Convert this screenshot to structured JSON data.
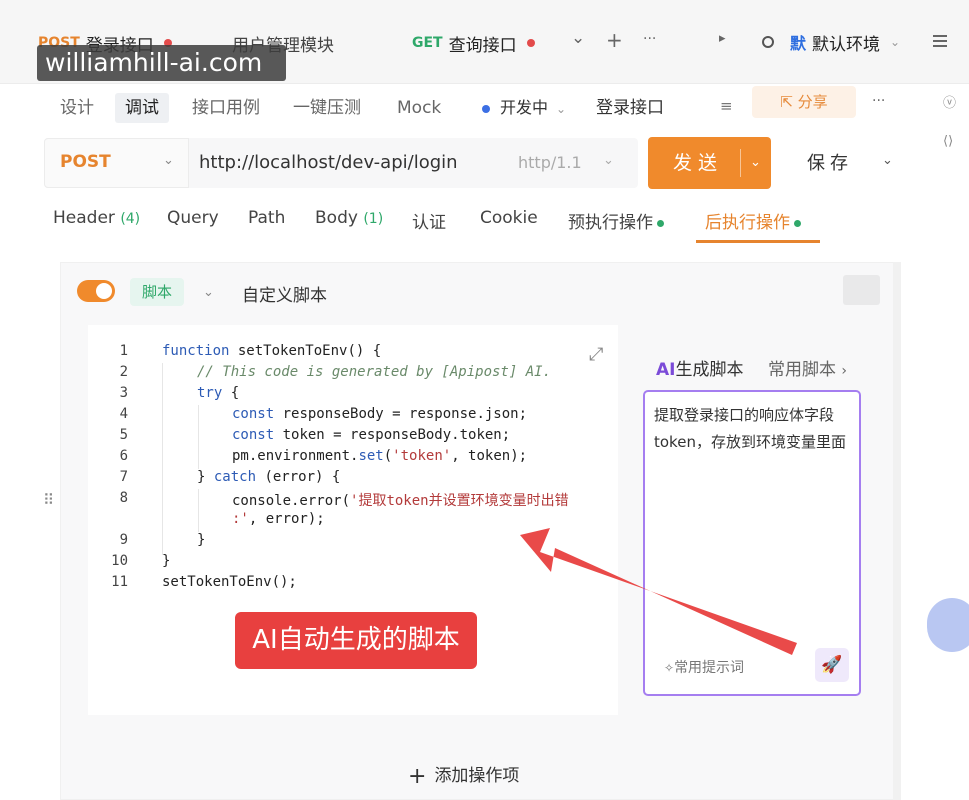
{
  "tabs": [
    {
      "method": "POST",
      "title": "登录接口",
      "dirty": true
    },
    {
      "method": "",
      "title": "用户管理模块",
      "dirty": false
    },
    {
      "method": "GET",
      "title": "查询接口",
      "dirty": true
    }
  ],
  "tab_controls": {
    "dropdown": "⌄",
    "add": "+",
    "more": "···",
    "next": "▸"
  },
  "environment": {
    "icon": "默",
    "label": "默认环境"
  },
  "watermark": "williamhill-ai.com",
  "subtabs": [
    "设计",
    "调试",
    "接口用例",
    "一键压测",
    "Mock"
  ],
  "active_subtab": "调试",
  "status": "开发中",
  "request_name": "登录接口",
  "share_label": "分享",
  "request": {
    "method": "POST",
    "url": "http://localhost/dev-api/login",
    "protocol": "http/1.1",
    "send_label": "发送",
    "save_label": "保存"
  },
  "request_tabs": [
    {
      "label": "Header",
      "count": "(4)"
    },
    {
      "label": "Query",
      "count": ""
    },
    {
      "label": "Path",
      "count": ""
    },
    {
      "label": "Body",
      "count": "(1)"
    },
    {
      "label": "认证",
      "count": ""
    },
    {
      "label": "Cookie",
      "count": ""
    },
    {
      "label": "预执行操作",
      "count": ""
    },
    {
      "label": "后执行操作",
      "count": ""
    }
  ],
  "active_request_tab": "后执行操作",
  "script": {
    "enabled": true,
    "tag": "脚本",
    "title": "自定义脚本",
    "line_numbers": [
      "1",
      "2",
      "3",
      "4",
      "5",
      "6",
      "7",
      "8",
      "",
      "9",
      "10",
      "11"
    ]
  },
  "ai_panel": {
    "tab_ai_prefix": "AI",
    "tab_generate": "生成脚本",
    "tab_common": "常用脚本",
    "prompt": "提取登录接口的响应体字段token，存放到环境变量里面",
    "hint": "常用提示词"
  },
  "annotation": "AI自动生成的脚本",
  "add_operation": "添加操作项",
  "colors": {
    "accent": "#f08a2c",
    "ai_purple": "#a57ef0",
    "annotation_red": "#e8403f"
  }
}
